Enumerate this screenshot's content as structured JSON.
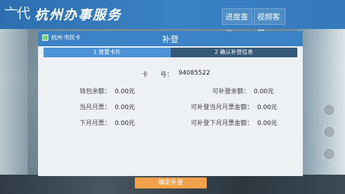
{
  "brand": {
    "logo_glyph": "亠代",
    "title": "杭州办事服务"
  },
  "top_buttons": {
    "progress": "进度查询",
    "video": "视频客服"
  },
  "panel": {
    "breadcrumb": "杭州·市民卡",
    "title": "补登",
    "steps": [
      "1 放置卡片",
      "2 确认补登信息"
    ],
    "card": {
      "label": "卡　　号：",
      "value": "94085522"
    },
    "fields": {
      "wallet": {
        "label": "钱包余额：",
        "value": "0.00元"
      },
      "month": {
        "label": "当月月票：",
        "value": "0.00元"
      },
      "next_month": {
        "label": "下月月票：",
        "value": "0.00元"
      },
      "supplement": {
        "label": "可补登余额：",
        "value": "0.00元"
      },
      "supplement_this_month": {
        "label": "可补登当月月票金额：",
        "value": "0.00元"
      },
      "supplement_next_month": {
        "label": "可补登下月月票金额：",
        "value": "0.00元"
      }
    },
    "confirm_label": "确定补登"
  },
  "colors": {
    "header_blue": "#3b83c6",
    "confirm_orange": "#f0a14a",
    "step_active": "#4b93d6",
    "step_inactive": "#36597a"
  }
}
